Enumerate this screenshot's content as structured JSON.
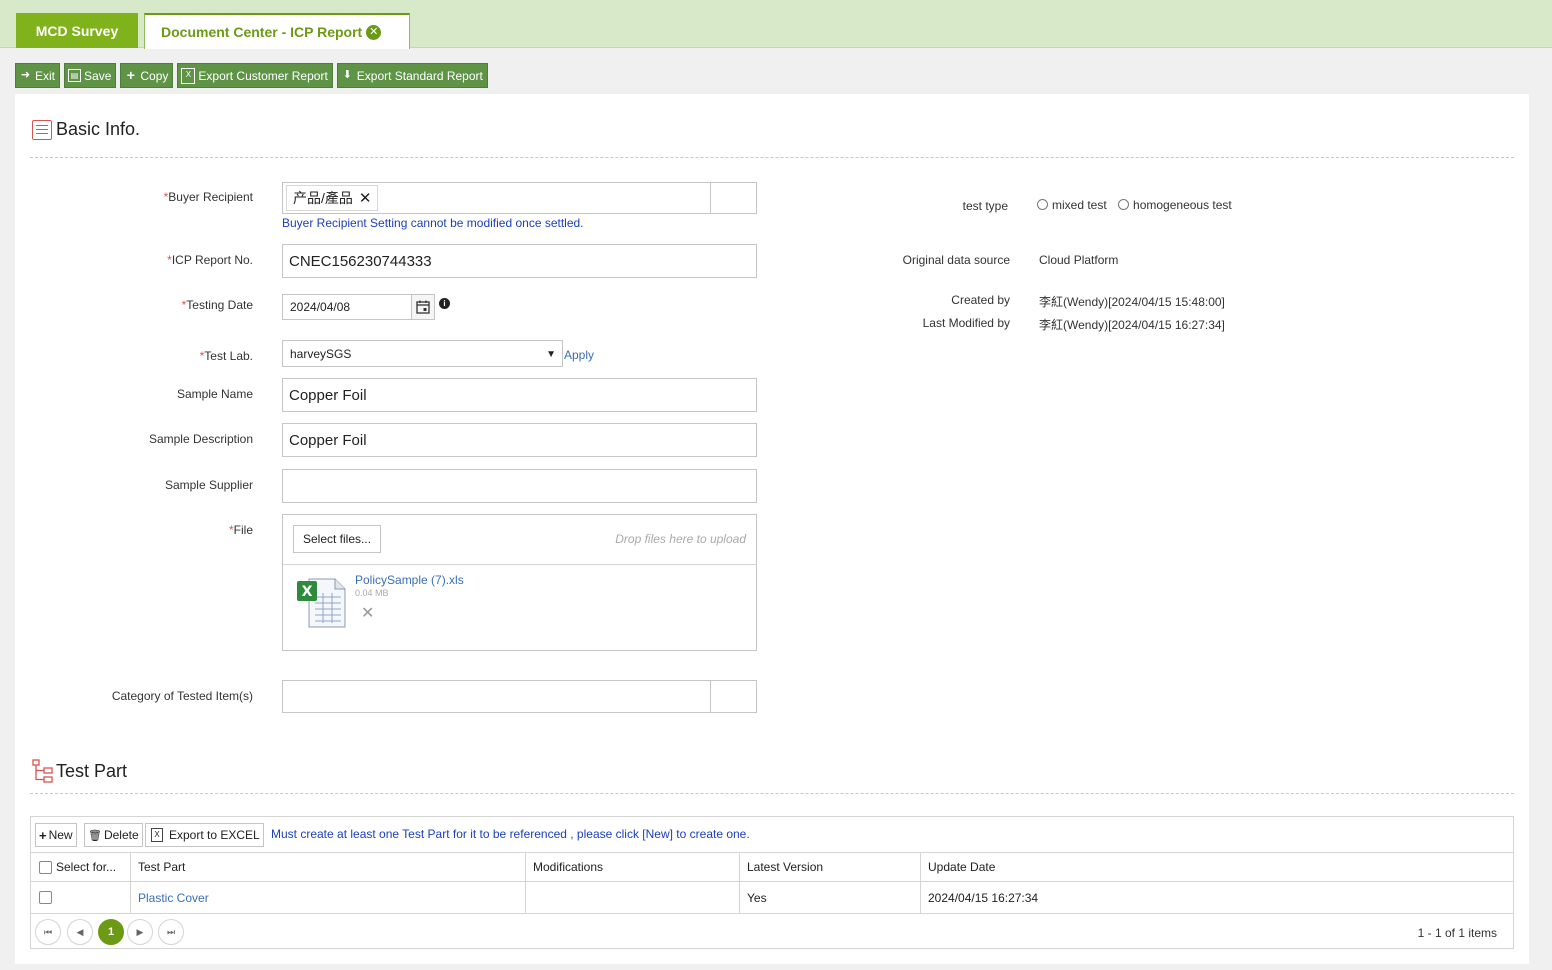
{
  "tabs": [
    {
      "label": "MCD Survey"
    },
    {
      "label": "Document Center - ICP Report"
    }
  ],
  "toolbar": {
    "exit": "Exit",
    "save": "Save",
    "copy": "Copy",
    "export_customer": "Export Customer Report",
    "export_standard": "Export Standard Report"
  },
  "basic_info": {
    "title": "Basic Info.",
    "buyer_recipient_label": "Buyer Recipient",
    "buyer_recipient_chip": "产品/產品",
    "buyer_hint": "Buyer Recipient Setting cannot be modified once settled.",
    "icp_label": "ICP Report No.",
    "icp_value": "CNEC156230744333",
    "testing_date_label": "Testing Date",
    "testing_date_value": "2024/04/08",
    "test_lab_label": "Test Lab.",
    "test_lab_value": "harveySGS",
    "apply": "Apply",
    "sample_name_label": "Sample Name",
    "sample_name_value": "Copper Foil",
    "sample_desc_label": "Sample Description",
    "sample_desc_value": "Copper Foil",
    "sample_supplier_label": "Sample Supplier",
    "sample_supplier_value": "",
    "file_label": "File",
    "select_files": "Select files...",
    "drop_hint": "Drop files here to upload",
    "file_name": "PolicySample (7).xls",
    "file_size": "0.04 MB",
    "category_label": "Category of Tested Item(s)",
    "required_mark": "*"
  },
  "side_info": {
    "test_type_label": "test type",
    "mixed_test": "mixed test",
    "homogeneous_test": "homogeneous test",
    "source_label": "Original data source",
    "source_value": "Cloud Platform",
    "created_label": "Created by",
    "created_value": "李紅(Wendy)[2024/04/15 15:48:00]",
    "modified_label": "Last Modified by",
    "modified_value": "李紅(Wendy)[2024/04/15 16:27:34]"
  },
  "test_part": {
    "title": "Test Part",
    "new": "New",
    "delete": "Delete",
    "export_excel": "Export to EXCEL",
    "message": "Must create at least one Test Part for it to be referenced , please click [New] to create one.",
    "columns": [
      "Select for...",
      "Test Part",
      "Modifications",
      "Latest Version",
      "Update Date"
    ],
    "rows": [
      {
        "test_part": "Plastic Cover",
        "modifications": "",
        "latest_version": "Yes",
        "update_date": "2024/04/15 16:27:34"
      }
    ],
    "page": "1",
    "page_info": "1 - 1 of 1 items"
  }
}
